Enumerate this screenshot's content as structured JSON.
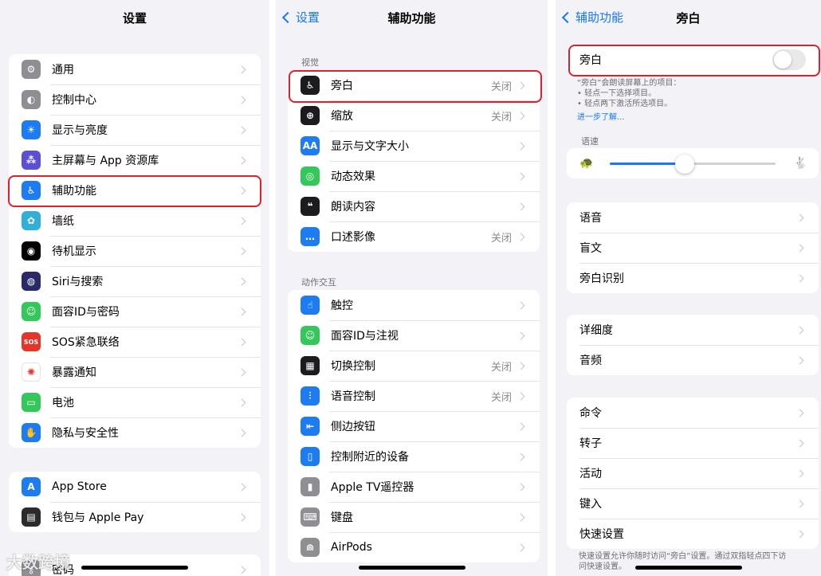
{
  "settings": {
    "title": "设置",
    "group1": [
      {
        "label": "通用",
        "icon": "gear-icon",
        "color": "#8e8e93",
        "glyph": "⚙"
      },
      {
        "label": "控制中心",
        "icon": "toggles-icon",
        "color": "#8e8e93",
        "glyph": "◐"
      },
      {
        "label": "显示与亮度",
        "icon": "sun-icon",
        "color": "#1e7cf2",
        "glyph": "☀"
      },
      {
        "label": "主屏幕与 App 资源库",
        "icon": "home-screen-icon",
        "color": "#5b4fd6",
        "glyph": "⁂"
      },
      {
        "label": "辅助功能",
        "icon": "accessibility-icon",
        "color": "#1e7cf2",
        "glyph": "♿"
      },
      {
        "label": "墙纸",
        "icon": "flower-icon",
        "color": "#30b0d8",
        "glyph": "✿"
      },
      {
        "label": "待机显示",
        "icon": "standby-icon",
        "color": "#000000",
        "glyph": "◉"
      },
      {
        "label": "Siri与搜索",
        "icon": "siri-icon",
        "color": "#2a2a6a",
        "glyph": "◍"
      },
      {
        "label": "面容ID与密码",
        "icon": "face-id-icon",
        "color": "#34c759",
        "glyph": "☺"
      },
      {
        "label": "SOS紧急联络",
        "icon": "sos-icon",
        "color": "#e5352b",
        "glyph": "SOS"
      },
      {
        "label": "暴露通知",
        "icon": "exposure-icon",
        "color": "#ffffff",
        "glyph": "✺"
      },
      {
        "label": "电池",
        "icon": "battery-icon",
        "color": "#34c759",
        "glyph": "▭"
      },
      {
        "label": "隐私与安全性",
        "icon": "hand-icon",
        "color": "#1e7cf2",
        "glyph": "✋"
      }
    ],
    "group2": [
      {
        "label": "App Store",
        "icon": "app-store-icon",
        "color": "#1e7cf2",
        "glyph": "A"
      },
      {
        "label": "钱包与 Apple Pay",
        "icon": "wallet-icon",
        "color": "#2b2b2b",
        "glyph": "▤"
      }
    ],
    "group3": [
      {
        "label": "密码",
        "icon": "key-icon",
        "color": "#8e8e93",
        "glyph": "⚷"
      }
    ]
  },
  "accessibility": {
    "back": "设置",
    "title": "辅助功能",
    "section_vision": "视觉",
    "vision": [
      {
        "label": "旁白",
        "value": "关闭",
        "icon": "voiceover-icon",
        "color": "#1c1c1e",
        "glyph": "♿"
      },
      {
        "label": "缩放",
        "value": "关闭",
        "icon": "zoom-icon",
        "color": "#1c1c1e",
        "glyph": "⊕"
      },
      {
        "label": "显示与文字大小",
        "value": "",
        "icon": "text-size-icon",
        "color": "#1e7cf2",
        "glyph": "AA"
      },
      {
        "label": "动态效果",
        "value": "",
        "icon": "motion-icon",
        "color": "#34c759",
        "glyph": "◎"
      },
      {
        "label": "朗读内容",
        "value": "",
        "icon": "speech-icon",
        "color": "#1c1c1e",
        "glyph": "❝"
      },
      {
        "label": "口述影像",
        "value": "关闭",
        "icon": "audio-description-icon",
        "color": "#1e7cf2",
        "glyph": "…"
      }
    ],
    "section_interaction": "动作交互",
    "interaction": [
      {
        "label": "触控",
        "value": "",
        "icon": "touch-icon",
        "color": "#1e7cf2",
        "glyph": "☝"
      },
      {
        "label": "面容ID与注视",
        "value": "",
        "icon": "face-id-attention-icon",
        "color": "#34c759",
        "glyph": "☺"
      },
      {
        "label": "切换控制",
        "value": "关闭",
        "icon": "switch-control-icon",
        "color": "#1c1c1e",
        "glyph": "▦"
      },
      {
        "label": "语音控制",
        "value": "关闭",
        "icon": "voice-control-icon",
        "color": "#1e7cf2",
        "glyph": "⫶"
      },
      {
        "label": "侧边按钮",
        "value": "",
        "icon": "side-button-icon",
        "color": "#1e7cf2",
        "glyph": "⇤"
      },
      {
        "label": "控制附近的设备",
        "value": "",
        "icon": "nearby-devices-icon",
        "color": "#1e7cf2",
        "glyph": "▯"
      },
      {
        "label": "Apple TV遥控器",
        "value": "",
        "icon": "remote-icon",
        "color": "#8e8e93",
        "glyph": "▮"
      },
      {
        "label": "键盘",
        "value": "",
        "icon": "keyboard-icon",
        "color": "#8e8e93",
        "glyph": "⌨"
      },
      {
        "label": "AirPods",
        "value": "",
        "icon": "airpods-icon",
        "color": "#8e8e93",
        "glyph": "⋒"
      }
    ]
  },
  "voiceover": {
    "back": "辅助功能",
    "title": "旁白",
    "toggle_label": "旁白",
    "toggle_on": false,
    "note_line1": "“旁白”会朗读屏幕上的项目：",
    "note_line2": "• 轻点一下选择项目。",
    "note_line3": "• 轻点两下激活所选项目。",
    "learn_more": "进一步了解...",
    "speed_label": "语速",
    "speed_level": 0.45,
    "group1": [
      "语音",
      "盲文",
      "旁白识别"
    ],
    "group2": [
      "详细度",
      "音频"
    ],
    "group3": [
      "命令",
      "转子",
      "活动",
      "键入",
      "快速设置"
    ],
    "footer": "快速设置允许你随时访问“旁白”设置。通过双指轻点四下访问快速设置。"
  },
  "watermark": "大数跨境",
  "colors": {
    "highlight": "#e0202c",
    "accent": "#1677ff"
  }
}
